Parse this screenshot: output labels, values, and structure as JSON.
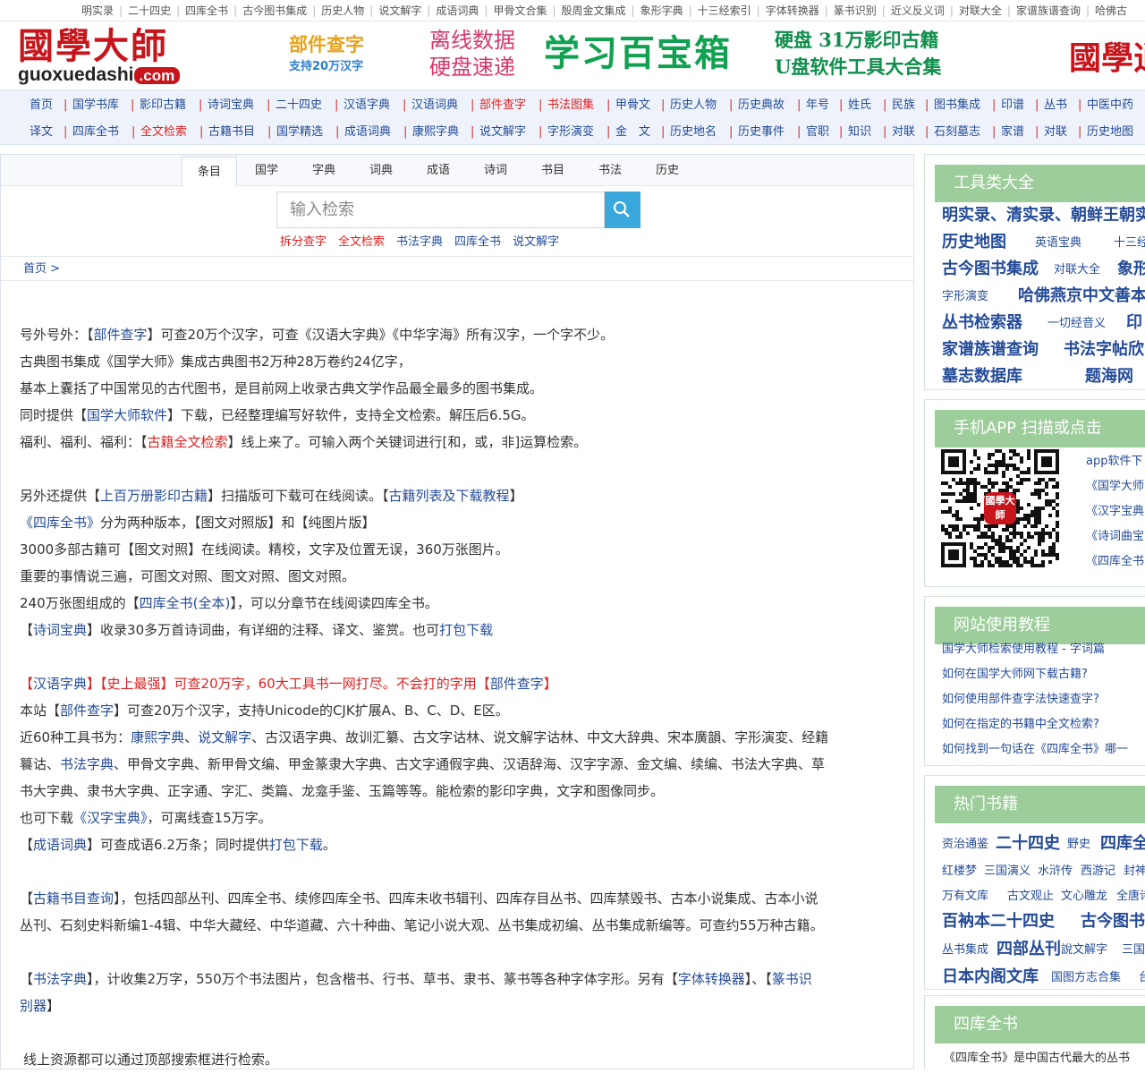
{
  "topbar": {
    "items": [
      "明实录",
      "二十四史",
      "四库全书",
      "古今图书集成",
      "历史人物",
      "说文解字",
      "成语词典",
      "甲骨文合集",
      "殷周金文集成",
      "象形字典",
      "十三经索引",
      "字体转换器",
      "篆书识别",
      "近义反义词",
      "对联大全",
      "家谱族谱查询",
      "哈佛古"
    ]
  },
  "banner": {
    "logo_big": "國學大師",
    "logo_small": "guoxuedashi",
    "logo_com": ".com",
    "ad1_title": "部件查字",
    "ad1_sub": "支持20万汉字",
    "ad2_line1": "离线数据",
    "ad2_line2": "硬盘速递",
    "ad3": "学习百宝箱",
    "ad4_line1": "硬盘 31万影印古籍",
    "ad4_line2": "U盘软件工具大合集",
    "ad5": "國學逍"
  },
  "nav": {
    "row1": [
      "首页",
      "国学书库",
      "影印古籍",
      "诗词宝典",
      "二十四史",
      "汉语字典",
      "汉语词典",
      "部件查字",
      "书法图集",
      "甲骨文",
      "历史人物",
      "历史典故",
      "年号",
      "姓氏",
      "民族",
      "图书集成",
      "印谱",
      "丛书",
      "中医中药"
    ],
    "row2": [
      "译文",
      "四库全书",
      "全文检索",
      "古籍书目",
      "国学精选",
      "成语词典",
      "康熙字典",
      "说文解字",
      "字形演变",
      "金　文",
      "历史地名",
      "历史事件",
      "官职",
      "知识",
      "对联",
      "石刻墓志",
      "家谱",
      "对联",
      "历史地图"
    ],
    "row1_red": [
      7,
      8
    ],
    "row2_red": [
      2
    ]
  },
  "tabs": [
    "条目",
    "国学",
    "字典",
    "词典",
    "成语",
    "诗词",
    "书目",
    "书法",
    "历史"
  ],
  "search": {
    "placeholder": "输入检索",
    "quick": [
      "拆分查字",
      "全文检索",
      "书法字典",
      "四库全书",
      "说文解字"
    ]
  },
  "breadcrumb": "首页 >",
  "content": {
    "p1": {
      "a": "号外号外：【",
      "b": "部件查字",
      "c": "】可查20万个汉字，可查《汉语大字典》《中华字海》所有汉字，一个字不少。"
    },
    "p2": "古典图书集成《国学大师》集成古典图书2万种28万卷约24亿字，",
    "p3": "基本上囊括了中国常见的古代图书，是目前网上收录古典文学作品最全最多的图书集成。",
    "p4": {
      "a": "同时提供【",
      "b": "国学大师软件",
      "c": "】下载，已经整理编写好软件，支持全文检索。解压后6.5G。"
    },
    "p5": {
      "a": "福利、福利、福利：【",
      "b": "古籍全文检索",
      "c": "】线上来了。可输入两个关键词进行[和，或，非]运算检索。"
    },
    "p6": {
      "a": "另外还提供【",
      "b": "上百万册影印古籍",
      "c": "】扫描版可下载可在线阅读。【",
      "d": "古籍列表及下载教程",
      "e": "】"
    },
    "p7": {
      "a": "《四库全书》",
      "b": "分为两种版本，【图文对照版】和【纯图片版】"
    },
    "p8": "3000多部古籍可【图文对照】在线阅读。精校，文字及位置无误，360万张图片。",
    "p9": "重要的事情说三遍，可图文对照、图文对照、图文对照。",
    "p10": {
      "a": "240万张图组成的【",
      "b": "四库全书(全本)",
      "c": "】，可以分章节在线阅读四库全书。"
    },
    "p11": {
      "a": "【",
      "b": "诗词宝典",
      "c": "】收录30多万首诗词曲，有详细的注释、译文、鉴赏。也可",
      "d": "打包下载"
    },
    "p12": {
      "a": "【",
      "b": "汉语字典",
      "c": "】【史上最强】可查20万字，60大工具书一网打尽。不会打的字用【",
      "d": "部件查字",
      "e": "】"
    },
    "p13": {
      "a": "本站【",
      "b": "部件查字",
      "c": "】可查20万个汉字，支持Unicode的CJK扩展A、B、C、D、E区。"
    },
    "p14": {
      "a": "近60种工具书为：",
      "b": "康熙字典",
      "c": "、",
      "d": "说文解字",
      "e": "、古汉语字典、故训汇纂、古文字诂林、说文解字诂林、中文大辞典、宋本廣韻、字形演変、经籍"
    },
    "p15": {
      "a": "籑诂、",
      "b": "书法字典",
      "c": "、甲骨文字典、新甲骨文编、甲金篆隶大字典、古文字通假字典、汉语辞海、汉字字源、金文编、续编、书法大字典、草"
    },
    "p16": "书大字典、隶书大字典、正字通、字汇、类篇、龙龛手鉴、玉篇等等。能检索的影印字典，文字和图像同步。",
    "p17": {
      "a": "也可下载",
      "b": "《汉字宝典》",
      "c": "，可离线查15万字。"
    },
    "p18": {
      "a": "【",
      "b": "成语词典",
      "c": "】可查成语6.2万条；同时提供",
      "d": "打包下载",
      "e": "。"
    },
    "p19": {
      "a": "【",
      "b": "古籍书目查询",
      "c": "】，包括四部丛刊、四库全书、续修四库全书、四库未收书辑刊、四库存目丛书、四库禁毁书、古本小说集成、古本小说"
    },
    "p20": "丛刊、石刻史料新编1-4辑、中华大藏经、中华道藏、六十种曲、笔记小说大观、丛书集成初编、丛书集成新编等。可查约55万种古籍。",
    "p21": {
      "a": "【",
      "b": "书法字典",
      "c": "】，计收集2万字，550万个书法图片，包含楷书、行书、草书、隶书、篆书等各种字体字形。另有【",
      "d": "字体转换器",
      "e": "】、【",
      "f": "篆书识"
    },
    "p22": {
      "a": "别器",
      "b": "】"
    },
    "p23": "线上资源都可以通过顶部搜索框进行检索。"
  },
  "sidebar": {
    "tools": {
      "title": "工具类大全",
      "items": [
        "明实录、清实录、朝鲜王朝实",
        "历史地图",
        "英语宝典",
        "十三经",
        "古今图书集成",
        "对联大全",
        "象形",
        "字形演变",
        "哈佛燕京中文善本",
        "丛书检索器",
        "一切经音义",
        "印",
        "家谱族谱查询",
        "书法字帖欣",
        "墓志数据库",
        "题海网"
      ]
    },
    "app": {
      "title": "手机APP 扫描或点击",
      "qr_label": "國學大師",
      "links": [
        "app软件下",
        "《国学大师",
        "《汉字宝典",
        "《诗词曲宝",
        "《四库全书"
      ]
    },
    "guide": {
      "title": "网站使用教程",
      "links": [
        "国学大师检索使用教程 - 字词篇",
        "如何在国学大师网下载古籍?",
        "如何使用部件查字法快速查字?",
        "如何在指定的书籍中全文检索?",
        "如何找到一句话在《四库全书》哪一"
      ]
    },
    "hot": {
      "title": "热门书籍",
      "items": [
        "资治通鉴",
        "二十四史",
        "野史",
        "四库全",
        "红楼梦",
        "三国演义",
        "水浒传",
        "西游记",
        "封神",
        "万有文库",
        "古文观止",
        "文心雕龙",
        "全唐诗",
        "百衲本二十四史",
        "古今图书",
        "丛书集成",
        "四部丛刊",
        "說文解字",
        "三国",
        "日本内阁文库",
        "国图方志合集",
        "台"
      ]
    },
    "siku": {
      "title": "四库全书",
      "text": "《四库全书》是中国古代最大的丛书"
    }
  }
}
